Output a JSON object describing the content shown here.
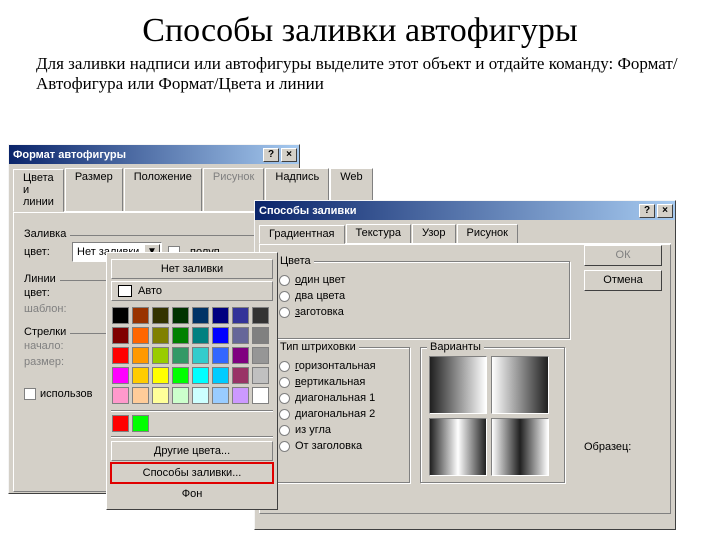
{
  "page": {
    "title": "Способы заливки автофигуры",
    "instruction": "Для заливки надписи или автофигуры выделите  этот объект и отдайте команду: Формат/Автофигура или Формат/Цвета и линии"
  },
  "dlg1": {
    "title": "Формат автофигуры",
    "help": "?",
    "close": "×",
    "tabs": {
      "colors": "Цвета и линии",
      "size": "Размер",
      "position": "Положение",
      "picture": "Рисунок",
      "text": "Надпись",
      "web": "Web"
    },
    "groups": {
      "fill": {
        "label": "Заливка",
        "color_lab": "цвет:",
        "sel_value": "Нет заливки",
        "semi_label": "полуп"
      },
      "lines": {
        "label": "Линии",
        "color_lab": "цвет:",
        "pattern_lab": "шаблон:"
      },
      "arrows": {
        "label": "Стрелки",
        "start_lab": "начало:",
        "size_lab": "размер:"
      },
      "use_default": "использов"
    }
  },
  "colorpop": {
    "none": "Нет заливки",
    "auto": "Авто",
    "row1": [
      "#000000",
      "#993300",
      "#333300",
      "#003300",
      "#003366",
      "#000080",
      "#333399",
      "#333333"
    ],
    "row2": [
      "#800000",
      "#ff6600",
      "#808000",
      "#008000",
      "#008080",
      "#0000ff",
      "#666699",
      "#808080"
    ],
    "row3": [
      "#ff0000",
      "#ff9900",
      "#99cc00",
      "#339966",
      "#33cccc",
      "#3366ff",
      "#800080",
      "#969696"
    ],
    "row4": [
      "#ff00ff",
      "#ffcc00",
      "#ffff00",
      "#00ff00",
      "#00ffff",
      "#00ccff",
      "#993366",
      "#c0c0c0"
    ],
    "row5": [
      "#ff99cc",
      "#ffcc99",
      "#ffff99",
      "#ccffcc",
      "#ccffff",
      "#99ccff",
      "#cc99ff",
      "#ffffff"
    ],
    "extra": [
      "#ff0000",
      "#00ff00"
    ],
    "more": "Другие цвета...",
    "fx": "Способы заливки...",
    "bg": "Фон"
  },
  "dlg2": {
    "title": "Способы заливки",
    "help": "?",
    "close": "×",
    "tabs": {
      "gradient": "Градиентная",
      "texture": "Текстура",
      "pattern": "Узор",
      "picture": "Рисунок"
    },
    "ok": "ОК",
    "cancel": "Отмена",
    "colors_grp": "Цвета",
    "radios_colors": {
      "one": "один цвет",
      "two": "два цвета",
      "preset": "заготовка"
    },
    "shade_grp": "Тип штриховки",
    "radios_shade": {
      "h": "горизонтальная",
      "v": "вертикальная",
      "d1": "диагональная 1",
      "d2": "диагональная 2",
      "corner": "из угла",
      "title": "От заголовка"
    },
    "variants_lab": "Варианты",
    "sample_lab": "Образец:"
  }
}
